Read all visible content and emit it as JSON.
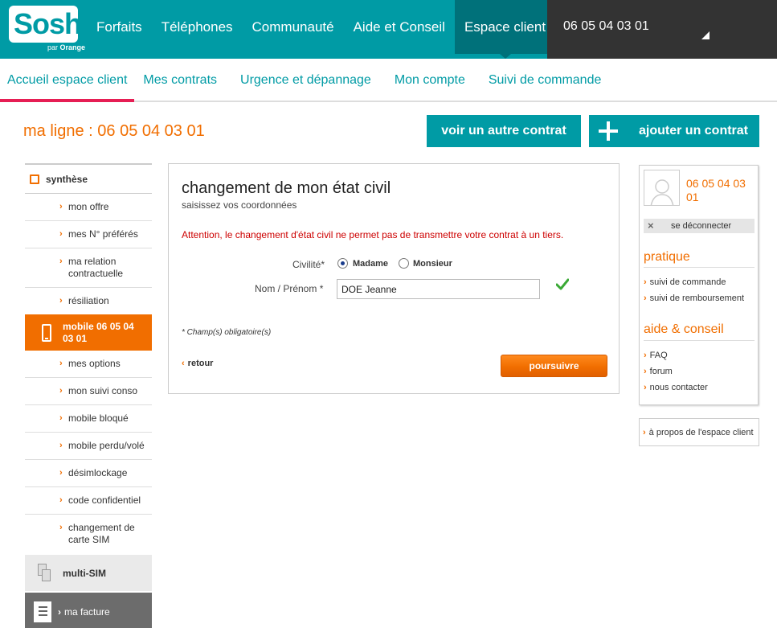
{
  "brand": {
    "name": "Sosh",
    "sub_prefix": "par",
    "sub_brand": "Orange"
  },
  "topnav": {
    "items": [
      {
        "label": "Forfaits"
      },
      {
        "label": "Téléphones"
      },
      {
        "label": "Communauté"
      },
      {
        "label": "Aide et Conseil"
      },
      {
        "label": "Espace client",
        "active": true
      }
    ],
    "account_number": "06 05 04 03 01"
  },
  "subnav": {
    "items": [
      {
        "label": "Accueil espace client",
        "active": true
      },
      {
        "label": "Mes contrats"
      },
      {
        "label": "Urgence et dépannage"
      },
      {
        "label": "Mon compte"
      },
      {
        "label": "Suivi de commande"
      }
    ]
  },
  "line": {
    "title": "ma ligne : 06 05 04 03 01",
    "other_contract_label": "voir un autre contrat",
    "add_contract_label": "ajouter un contrat"
  },
  "leftmenu": {
    "synthese": "synthèse",
    "items_top": [
      "mon offre",
      "mes N° préférés",
      "ma relation contractuelle",
      "résiliation"
    ],
    "mobile_label": "mobile 06 05 04 03 01",
    "items_mobile": [
      "mes options",
      "mon suivi conso",
      "mobile bloqué",
      "mobile perdu/volé",
      "désimlockage",
      "code confidentiel",
      "changement de carte SIM"
    ],
    "multisim": "multi-SIM",
    "facture": "ma facture"
  },
  "form": {
    "title": "changement de mon état civil",
    "subtitle": "saisissez vos coordonnées",
    "warning": "Attention, le changement d'état civil ne permet pas de transmettre votre contrat à un tiers.",
    "civility_label": "Civilité*",
    "option_madame": "Madame",
    "option_monsieur": "Monsieur",
    "selected": "Madame",
    "name_label": "Nom / Prénom *",
    "name_value": "DOE Jeanne",
    "required_note": "* Champ(s) obligatoire(s)",
    "back_label": "retour",
    "continue_label": "poursuivre"
  },
  "rightpanel": {
    "number": "06 05 04 03 01",
    "logout": "se déconnecter",
    "pratique_title": "pratique",
    "pratique_links": [
      "suivi de commande",
      "suivi de remboursement"
    ],
    "aide_title": "aide & conseil",
    "aide_links": [
      "FAQ",
      "forum",
      "nous contacter"
    ],
    "about": "à propos de l'espace client"
  },
  "colors": {
    "teal": "#009ba5",
    "orange": "#f16e00",
    "dark": "#333333",
    "accent_pink": "#e61e54",
    "warning_red": "#cd0000"
  }
}
